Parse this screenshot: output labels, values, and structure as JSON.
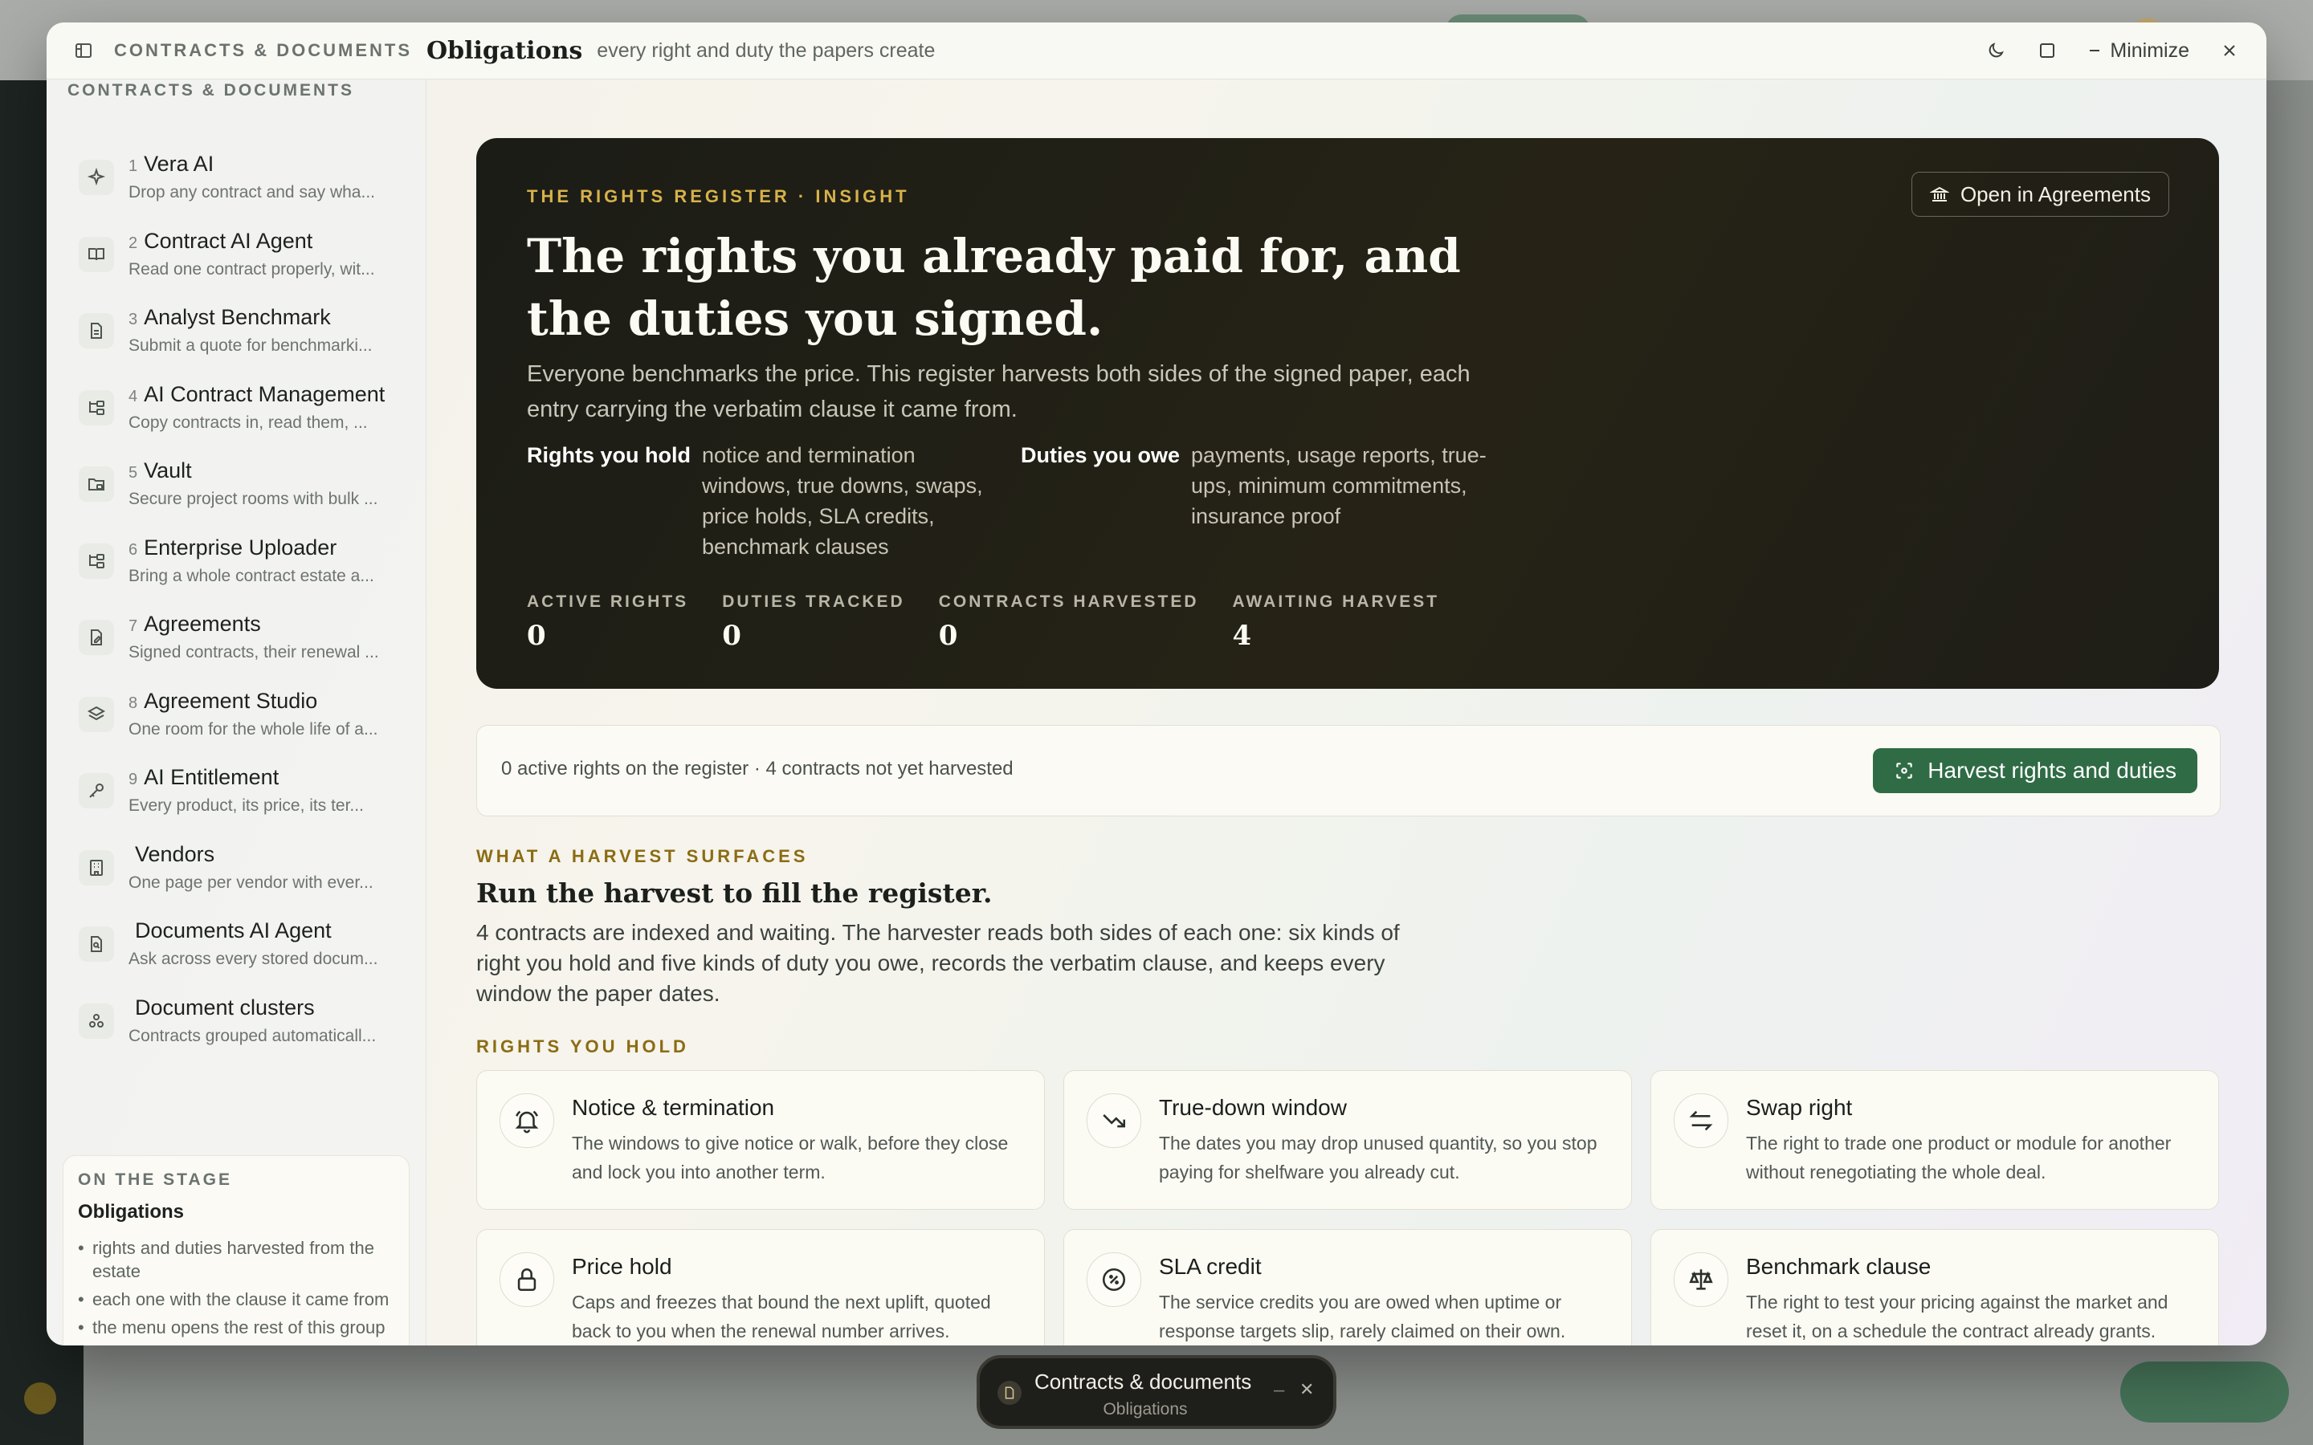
{
  "window": {
    "group": "CONTRACTS & DOCUMENTS",
    "title": "Obligations",
    "subtitle": "every right and duty the papers create",
    "minimize_label": "Minimize"
  },
  "nav": {
    "heading": "CONTRACTS & DOCUMENTS",
    "items": [
      {
        "num": "1",
        "title": "Vera AI",
        "desc": "Drop any contract and say wha...",
        "icon": "sparkle-icon"
      },
      {
        "num": "2",
        "title": "Contract AI Agent",
        "desc": "Read one contract properly, wit...",
        "icon": "book-icon"
      },
      {
        "num": "3",
        "title": "Analyst Benchmark",
        "desc": "Submit a quote for benchmarki...",
        "icon": "document-icon"
      },
      {
        "num": "4",
        "title": "AI Contract Management",
        "desc": "Copy contracts in, read them, ...",
        "icon": "folder-tree-icon"
      },
      {
        "num": "5",
        "title": "Vault",
        "desc": "Secure project rooms with bulk ...",
        "icon": "folder-lock-icon"
      },
      {
        "num": "6",
        "title": "Enterprise Uploader",
        "desc": "Bring a whole contract estate a...",
        "icon": "folder-tree-icon"
      },
      {
        "num": "7",
        "title": "Agreements",
        "desc": "Signed contracts, their renewal ...",
        "icon": "file-edit-icon"
      },
      {
        "num": "8",
        "title": "Agreement Studio",
        "desc": "One room for the whole life of a...",
        "icon": "layers-icon"
      },
      {
        "num": "9",
        "title": "AI Entitlement",
        "desc": "Every product, its price, its ter...",
        "icon": "key-icon"
      },
      {
        "num": "",
        "title": "Vendors",
        "desc": "One page per vendor with ever...",
        "icon": "building-icon"
      },
      {
        "num": "",
        "title": "Documents AI Agent",
        "desc": "Ask across every stored docum...",
        "icon": "file-search-icon"
      },
      {
        "num": "",
        "title": "Document clusters",
        "desc": "Contracts grouped automaticall...",
        "icon": "cluster-icon"
      }
    ]
  },
  "stage": {
    "heading": "ON THE STAGE",
    "title": "Obligations",
    "points": [
      "rights and duties harvested from the estate",
      "each one with the clause it came from",
      "the menu opens the rest of this group"
    ]
  },
  "hero": {
    "kicker": "THE RIGHTS REGISTER · INSIGHT",
    "title": "The rights you already paid for, and the duties you signed.",
    "lead": "Everyone benchmarks the price. This register harvests both sides of the signed paper, each entry carrying the verbatim clause it came from.",
    "open_label": "Open in Agreements",
    "rights_label": "Rights you hold",
    "rights_text": "notice and termination windows, true downs, swaps, price holds, SLA credits, benchmark clauses",
    "duties_label": "Duties you owe",
    "duties_text": "payments, usage reports, true-ups, minimum commitments, insurance proof",
    "stats": [
      {
        "label": "ACTIVE RIGHTS",
        "value": "0"
      },
      {
        "label": "DUTIES TRACKED",
        "value": "0"
      },
      {
        "label": "CONTRACTS HARVESTED",
        "value": "0"
      },
      {
        "label": "AWAITING HARVEST",
        "value": "4"
      }
    ]
  },
  "harvest": {
    "status": "0 active rights on the register · 4 contracts not yet harvested",
    "button": "Harvest rights and duties"
  },
  "surfaces": {
    "kicker": "WHAT A HARVEST SURFACES",
    "title": "Run the harvest to fill the register.",
    "body": "4 contracts are indexed and waiting. The harvester reads both sides of each one: six kinds of right you hold and five kinds of duty you owe, records the verbatim clause, and keeps every window the paper dates."
  },
  "rights": {
    "kicker": "RIGHTS YOU HOLD",
    "cards": [
      {
        "title": "Notice & termination",
        "desc": "The windows to give notice or walk, before they close and lock you into another term.",
        "icon": "bell-icon"
      },
      {
        "title": "True-down window",
        "desc": "The dates you may drop unused quantity, so you stop paying for shelfware you already cut.",
        "icon": "trend-down-icon"
      },
      {
        "title": "Swap right",
        "desc": "The right to trade one product or module for another without renegotiating the whole deal.",
        "icon": "swap-icon"
      },
      {
        "title": "Price hold",
        "desc": "Caps and freezes that bound the next uplift, quoted back to you when the renewal number arrives.",
        "icon": "lock-icon"
      },
      {
        "title": "SLA credit",
        "desc": "The service credits you are owed when uptime or response targets slip, rarely claimed on their own.",
        "icon": "badge-percent-icon"
      },
      {
        "title": "Benchmark clause",
        "desc": "The right to test your pricing against the market and reset it, on a schedule the contract already grants.",
        "icon": "scale-icon"
      }
    ]
  },
  "dock": {
    "title": "Contracts & documents",
    "subtitle": "Obligations"
  },
  "colors": {
    "accent_green": "#2f6b45",
    "hero_dark": "#1d1d17",
    "gold": "#d7b24a",
    "section_gold": "#8b6c14"
  }
}
